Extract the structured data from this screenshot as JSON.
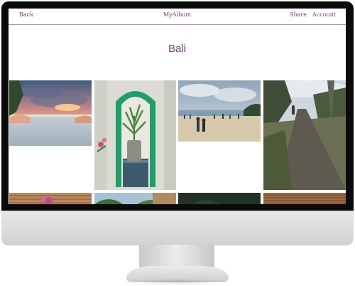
{
  "nav": {
    "back_label": "Back",
    "brand": "MyAlbum",
    "share_label": "Share",
    "account_label": "Account"
  },
  "album": {
    "title": "Bali"
  },
  "colors": {
    "accent": "#7b3f7f",
    "divider": "#b98fbd",
    "bezel": "#0b0b0b"
  },
  "photos": [
    {
      "name": "sunset-infinity-pool"
    },
    {
      "name": "green-doorway-plant"
    },
    {
      "name": "beach-crowd"
    },
    {
      "name": "dirt-road-trees"
    },
    {
      "name": "thatched-roof-flower"
    },
    {
      "name": "palm-treetops"
    },
    {
      "name": "dark-canopy"
    },
    {
      "name": "thatched-roof"
    }
  ]
}
